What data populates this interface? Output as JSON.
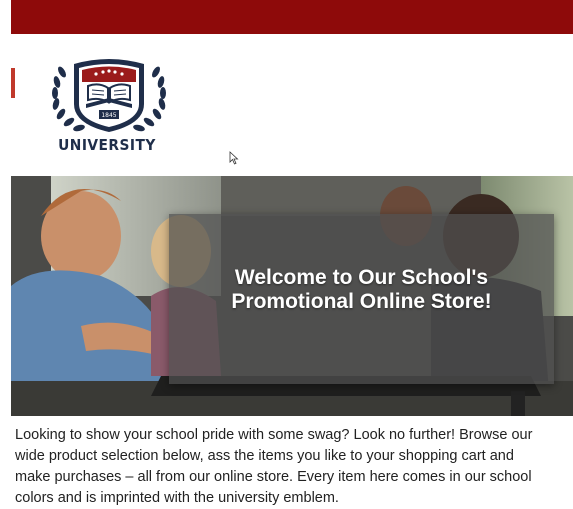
{
  "header": {
    "bar_color": "#8e0a0a"
  },
  "logo": {
    "text": "UNIVERSITY",
    "year": "1845",
    "icon": "university-emblem-icon"
  },
  "hero": {
    "heading_line1": "Welcome to Our School's",
    "heading_line2": "Promotional Online Store!"
  },
  "intro": {
    "line1": "Looking to show your school pride with some swag? Look no further! Browse our",
    "line2": "wide product selection below, ass the items you like to your shopping cart and",
    "line3": "make purchases – all from our online store. Every item here comes in our school",
    "line4": "colors and is imprinted with the university emblem."
  }
}
